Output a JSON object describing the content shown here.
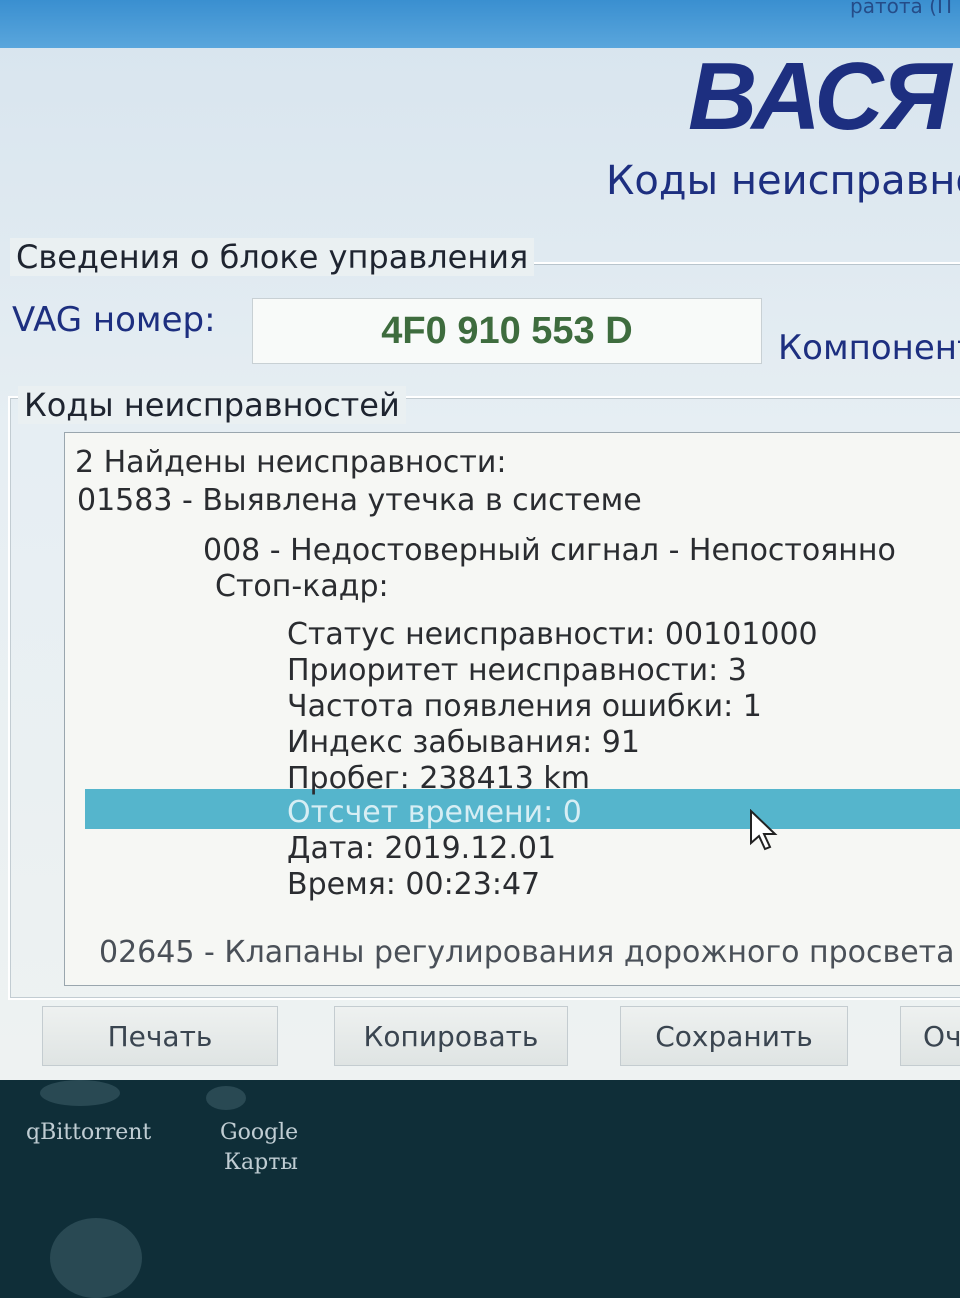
{
  "window": {
    "topbar_text": "ратота (П",
    "app_title": "ВАСЯ",
    "subtitle": "Коды неисправнос"
  },
  "control_unit": {
    "section_label": "Сведения о блоке управления",
    "vag_label": "VAG номер:",
    "vag_value": "4F0 910 553 D",
    "component_label": "Компонент:"
  },
  "faults": {
    "section_label": "Коды неисправностей",
    "lines": [
      "2 Найдены неисправности:",
      "01583 - Выявлена утечка в системе",
      "008 - Недостоверный сигнал - Непостоянно",
      "Стоп-кадр:",
      "Статус неисправности: 00101000",
      "Приоритет неисправности: 3",
      "Частота появления ошибки: 1",
      "Индекс забывания: 91",
      "Пробег: 238413 km",
      "Отсчет времени: 0",
      "Дата: 2019.12.01",
      "Время: 00:23:47",
      "02645 - Клапаны регулирования дорожного просвета"
    ]
  },
  "buttons": {
    "print": "Печать",
    "copy": "Копировать",
    "save": "Сохранить",
    "clear": "Оч"
  },
  "desktop": {
    "icon1": "qBittorrent",
    "icon2_line1": "Google",
    "icon2_line2": "Карты"
  },
  "colors": {
    "title_blue": "#1d2f80",
    "vag_green": "#3e6c3e",
    "selection": "#55b5cc"
  }
}
